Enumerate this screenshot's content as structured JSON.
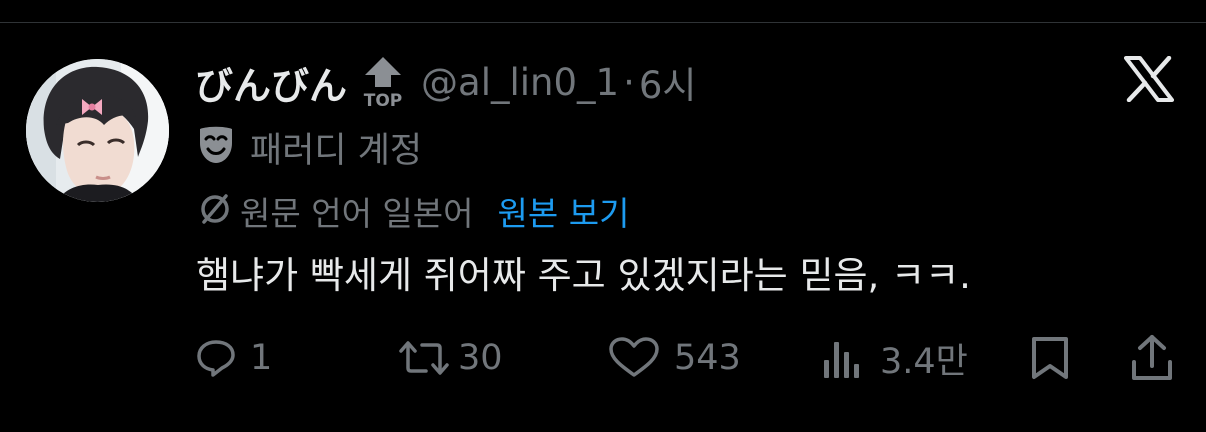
{
  "tweet": {
    "author": {
      "display_name": "びんびん",
      "handle": "@al_lin0_1",
      "badge_text": "TOP"
    },
    "separator": "·",
    "time": "6시",
    "parody_label": "패러디 계정",
    "translation": {
      "source_language_text": "원문 언어 일본어",
      "view_original_label": "원본 보기"
    },
    "text": "햄냐가 빡세게 쥐어짜 주고 있겠지라는 믿음, ㅋㅋ."
  },
  "actions": {
    "replies": "1",
    "retweets": "30",
    "likes": "543",
    "views": "3.4만"
  },
  "icons": {
    "platform": "x-logo-icon",
    "reply": "reply-icon",
    "retweet": "retweet-icon",
    "like": "heart-icon",
    "views": "views-icon",
    "bookmark": "bookmark-icon",
    "share": "share-icon",
    "parody": "mask-icon",
    "translation": "no-translate-icon"
  },
  "colors": {
    "background": "#000000",
    "primary_text": "#e7e9ea",
    "secondary_text": "#71767b",
    "link": "#1d9bf0",
    "divider": "#2f3336"
  }
}
